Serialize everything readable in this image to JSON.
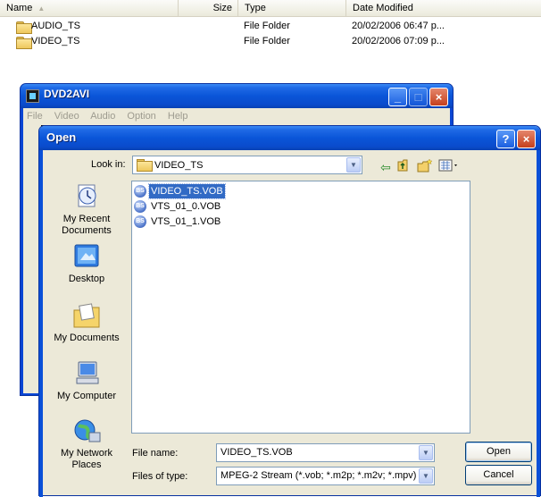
{
  "explorer": {
    "columns": {
      "name": "Name",
      "size": "Size",
      "type": "Type",
      "date": "Date Modified"
    },
    "rows": [
      {
        "name": "AUDIO_TS",
        "type": "File Folder",
        "date": "20/02/2006 06:47 p..."
      },
      {
        "name": "VIDEO_TS",
        "type": "File Folder",
        "date": "20/02/2006 07:09 p..."
      }
    ]
  },
  "dvd2avi": {
    "title": "DVD2AVI",
    "menu": [
      "File",
      "Video",
      "Audio",
      "Option",
      "Help"
    ],
    "minimize": "_",
    "close": "×"
  },
  "dialog": {
    "title": "Open",
    "help": "?",
    "close": "×",
    "look_in_label": "Look in:",
    "look_in_value": "VIDEO_TS",
    "places": [
      {
        "label": "My Recent Documents",
        "icon": "recent-documents-icon"
      },
      {
        "label": "Desktop",
        "icon": "desktop-icon"
      },
      {
        "label": "My Documents",
        "icon": "my-documents-icon"
      },
      {
        "label": "My Computer",
        "icon": "my-computer-icon"
      },
      {
        "label": "My Network Places",
        "icon": "network-places-icon"
      }
    ],
    "files": [
      {
        "name": "VIDEO_TS.VOB",
        "selected": true
      },
      {
        "name": "VTS_01_0.VOB",
        "selected": false
      },
      {
        "name": "VTS_01_1.VOB",
        "selected": false
      }
    ],
    "file_name_label": "File name:",
    "file_name_value": "VIDEO_TS.VOB",
    "files_of_type_label": "Files of type:",
    "files_of_type_value": "MPEG-2 Stream (*.vob; *.m2p; *.m2v; *.mpv)",
    "open_button": "Open",
    "cancel_button": "Cancel"
  }
}
